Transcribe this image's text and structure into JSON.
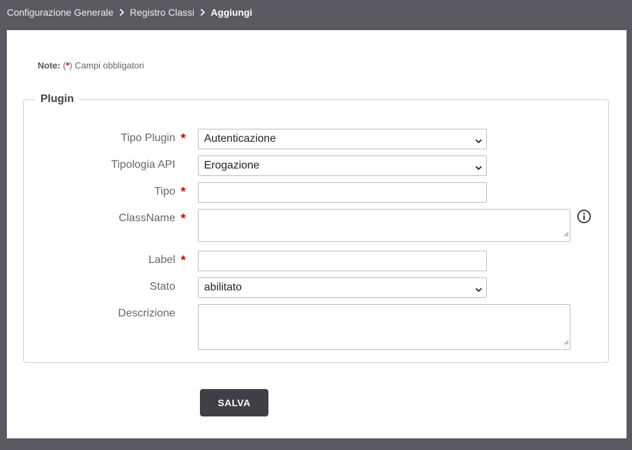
{
  "breadcrumb": {
    "items": [
      "Configurazione Generale",
      "Registro Classi",
      "Aggiungi"
    ]
  },
  "note": {
    "label": "Note:",
    "open": "(",
    "star": "*",
    "text": ") Campi obbligatori"
  },
  "fieldset": {
    "legend": "Plugin"
  },
  "fields": {
    "tipo_plugin": {
      "label": "Tipo Plugin",
      "required": "*",
      "value": "Autenticazione"
    },
    "tipologia_api": {
      "label": "Tipologia API",
      "value": "Erogazione"
    },
    "tipo": {
      "label": "Tipo",
      "required": "*",
      "value": ""
    },
    "classname": {
      "label": "ClassName",
      "required": "*",
      "value": ""
    },
    "label": {
      "label": "Label",
      "required": "*",
      "value": ""
    },
    "stato": {
      "label": "Stato",
      "value": "abilitato"
    },
    "descrizione": {
      "label": "Descrizione",
      "value": ""
    }
  },
  "actions": {
    "save_label": "SALVA"
  },
  "colors": {
    "required": "#d00000",
    "header_bg": "#5a5a60",
    "button_bg": "#3f3f45"
  },
  "icons": {
    "breadcrumb_separator": "chevron-right-icon",
    "select_arrow": "chevron-down-icon",
    "info": "info-circle-icon"
  }
}
